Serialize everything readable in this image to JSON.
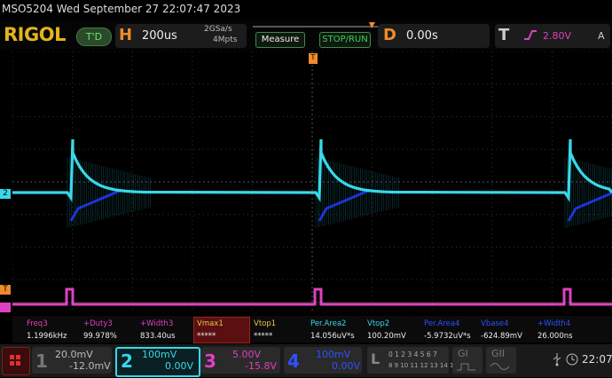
{
  "title": "MSO5204  Wed September 27 22:07:47 2023",
  "brand": "RIGOL",
  "trigger_status": "T'D",
  "horizontal": {
    "letter": "H",
    "timebase": "200us",
    "sample_rate": "2GSa/s",
    "memory": "4Mpts"
  },
  "buttons": {
    "measure": "Measure",
    "run_stop": "STOP/RUN"
  },
  "delay": {
    "letter": "D",
    "value": "0.00s"
  },
  "trigger": {
    "letter": "T",
    "level": "2.80V",
    "source": "A"
  },
  "markers": {
    "trigger_pos": "T",
    "ch2_marker": "2",
    "ch1_marker": "1",
    "ch3_marker": "T"
  },
  "measurements": [
    {
      "label": "Freq3",
      "value": "1.1996kHz",
      "color": "#e040c0"
    },
    {
      "label": "+Duty3",
      "value": "99.978%",
      "color": "#e040c0"
    },
    {
      "label": "+Width3",
      "value": "833.40us",
      "color": "#e040c0"
    },
    {
      "label": "Vmax1",
      "value": "*****",
      "color": "#e8c84a"
    },
    {
      "label": "Vtop1",
      "value": "*****",
      "color": "#e8c84a"
    },
    {
      "label": "Per.Area2",
      "value": "14.056uV*s",
      "color": "#38d8e8"
    },
    {
      "label": "Vtop2",
      "value": "100.20mV",
      "color": "#38d8e8"
    },
    {
      "label": "Per.Area4",
      "value": "-5.9732uV*s",
      "color": "#3050ff"
    },
    {
      "label": "Vbase4",
      "value": "-624.89mV",
      "color": "#3050ff"
    },
    {
      "label": "+Width4",
      "value": "26.000ns",
      "color": "#3050ff"
    }
  ],
  "channels": [
    {
      "num": "1",
      "scale": "20.0mV",
      "offset": "-12.0mV",
      "color": "#c9c9c9"
    },
    {
      "num": "2",
      "scale": "100mV",
      "offset": "0.00V",
      "color": "#38d8e8"
    },
    {
      "num": "3",
      "scale": "5.00V",
      "offset": "-15.8V",
      "color": "#e040c0"
    },
    {
      "num": "4",
      "scale": "100mV",
      "offset": "0.00V",
      "color": "#3050ff"
    }
  ],
  "logic": {
    "letter": "L",
    "row1": "0 1 2 3 4 5 6 7",
    "row2": "8 9 10 11 12 13 14 15"
  },
  "gi": "GI",
  "gii": "GII",
  "clock": "22:07"
}
